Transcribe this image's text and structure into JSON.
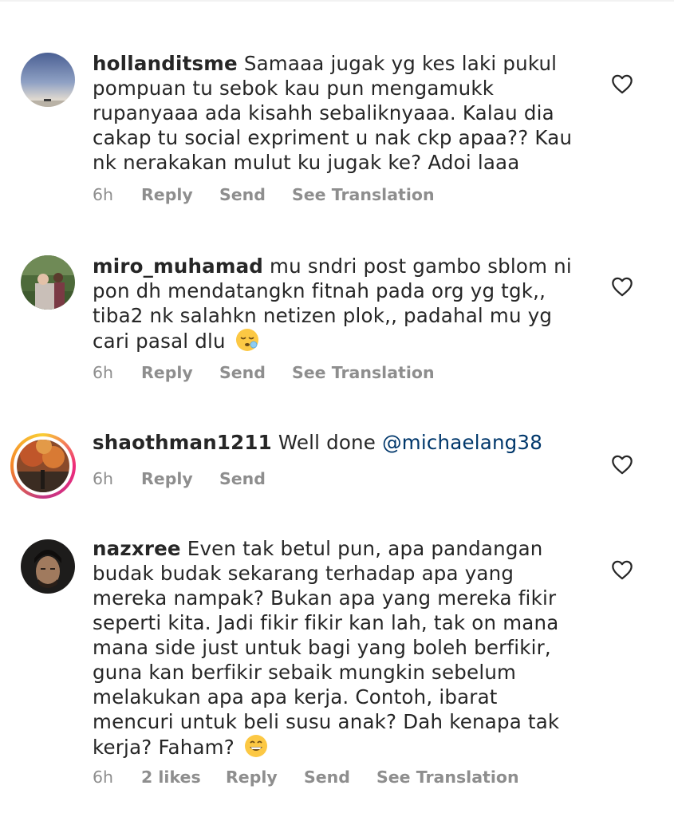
{
  "comments": [
    {
      "username": "hollanditsme",
      "text": "Samaaa jugak yg kes laki pukul pompuan tu sebok kau pun mengamukk rupanyaaa ada kisahh sebaliknyaaa. Kalau dia cakap tu social expriment u nak ckp apaa?? Kau nk nerakakan mulut ku jugak ke? Adoi laaa",
      "time": "6h",
      "reply": "Reply",
      "send": "Send",
      "translate": "See Translation"
    },
    {
      "username": "miro_muhamad",
      "text": "mu sndri post gambo sblom ni pon dh mendatangkn fitnah pada org yg tgk,, tiba2 nk salahkn netizen plok,, padahal mu yg cari pasal dlu",
      "emoji": "sleepy-face-emoji",
      "time": "6h",
      "reply": "Reply",
      "send": "Send",
      "translate": "See Translation"
    },
    {
      "username": "shaothman1211",
      "text": "Well done",
      "mention": "@michaelang38",
      "time": "6h",
      "reply": "Reply",
      "send": "Send"
    },
    {
      "username": "nazxree",
      "text": "Even tak betul pun, apa pandangan budak budak sekarang terhadap apa yang mereka nampak? Bukan apa yang mereka fikir seperti kita. Jadi fikir fikir kan lah, tak on mana mana side just untuk bagi yang boleh berfikir, guna kan berfikir sebaik mungkin sebelum melakukan apa apa kerja. Contoh, ibarat mencuri untuk beli susu anak? Dah kenapa tak kerja? Faham?",
      "emoji": "grinning-face-emoji",
      "time": "6h",
      "likes": "2 likes",
      "reply": "Reply",
      "send": "Send",
      "translate": "See Translation"
    }
  ],
  "icons": {
    "like": "heart-outline-icon"
  },
  "colors": {
    "meta": "#8e8e8e",
    "mention": "#00376b",
    "text": "#262626"
  }
}
